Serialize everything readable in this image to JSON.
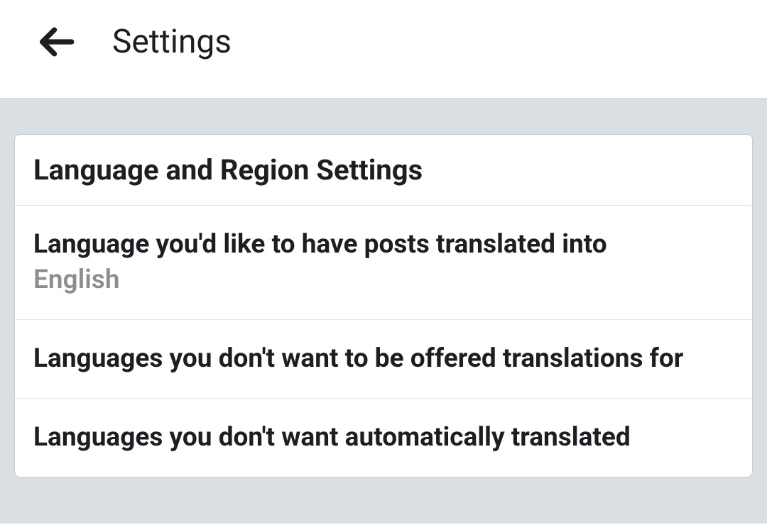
{
  "header": {
    "title": "Settings"
  },
  "section": {
    "heading": "Language and Region Settings",
    "items": [
      {
        "title": "Language you'd like to have posts translated into",
        "value": "English"
      },
      {
        "title": "Languages you don't want to be offered translations for",
        "value": ""
      },
      {
        "title": "Languages you don't want automatically translated",
        "value": ""
      }
    ]
  }
}
